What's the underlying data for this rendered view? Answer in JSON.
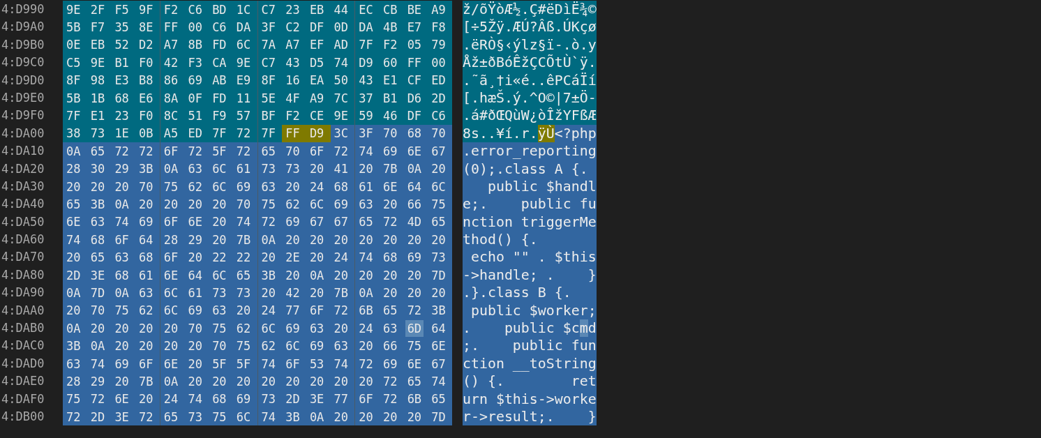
{
  "rows": [
    {
      "address": "4:D990",
      "hex": [
        {
          "kind": "region_a",
          "bytes": [
            "9E",
            "2F",
            "F5",
            "9F",
            "F2",
            "C6",
            "BD",
            "1C",
            "C7",
            "23",
            "EB",
            "44",
            "EC",
            "CB",
            "BE",
            "A9"
          ]
        }
      ],
      "ascii": [
        {
          "kind": "region_a",
          "text": "ž/õŸòÆ½.Ç#ëDìË¾©"
        }
      ]
    },
    {
      "address": "4:D9A0",
      "hex": [
        {
          "kind": "region_a",
          "bytes": [
            "5B",
            "F7",
            "35",
            "8E",
            "FF",
            "00",
            "C6",
            "DA",
            "3F",
            "C2",
            "DF",
            "0D",
            "DA",
            "4B",
            "E7",
            "F8"
          ]
        }
      ],
      "ascii": [
        {
          "kind": "region_a",
          "text": "[÷5Žÿ.ÆÚ?Âß.ÚKçø"
        }
      ]
    },
    {
      "address": "4:D9B0",
      "hex": [
        {
          "kind": "region_a",
          "bytes": [
            "0E",
            "EB",
            "52",
            "D2",
            "A7",
            "8B",
            "FD",
            "6C",
            "7A",
            "A7",
            "EF",
            "AD",
            "7F",
            "F2",
            "05",
            "79"
          ]
        }
      ],
      "ascii": [
        {
          "kind": "region_a",
          "text": ".ëRÒ§‹ýlz§ï-.ò.y"
        }
      ]
    },
    {
      "address": "4:D9C0",
      "hex": [
        {
          "kind": "region_a",
          "bytes": [
            "C5",
            "9E",
            "B1",
            "F0",
            "42",
            "F3",
            "CA",
            "9E",
            "C7",
            "43",
            "D5",
            "74",
            "D9",
            "60",
            "FF",
            "00"
          ]
        }
      ],
      "ascii": [
        {
          "kind": "region_a",
          "text": "Åž±ðBóÊžÇCÕtÙ`ÿ."
        }
      ]
    },
    {
      "address": "4:D9D0",
      "hex": [
        {
          "kind": "region_a",
          "bytes": [
            "8F",
            "98",
            "E3",
            "B8",
            "86",
            "69",
            "AB",
            "E9",
            "8F",
            "16",
            "EA",
            "50",
            "43",
            "E1",
            "CF",
            "ED"
          ]
        }
      ],
      "ascii": [
        {
          "kind": "region_a",
          "text": ".˜ã¸†i«é..êPCáÏí"
        }
      ]
    },
    {
      "address": "4:D9E0",
      "hex": [
        {
          "kind": "region_a",
          "bytes": [
            "5B",
            "1B",
            "68",
            "E6",
            "8A",
            "0F",
            "FD",
            "11",
            "5E",
            "4F",
            "A9",
            "7C",
            "37",
            "B1",
            "D6",
            "2D"
          ]
        }
      ],
      "ascii": [
        {
          "kind": "region_a",
          "text": "[.hæŠ.ý.^O©|7±Ö-"
        }
      ]
    },
    {
      "address": "4:D9F0",
      "hex": [
        {
          "kind": "region_a",
          "bytes": [
            "7F",
            "E1",
            "23",
            "F0",
            "8C",
            "51",
            "F9",
            "57",
            "BF",
            "F2",
            "CE",
            "9E",
            "59",
            "46",
            "DF",
            "C6"
          ]
        }
      ],
      "ascii": [
        {
          "kind": "region_a",
          "text": ".á#ðŒQùW¿òÎžYFßÆ"
        }
      ]
    },
    {
      "address": "4:DA00",
      "hex": [
        {
          "kind": "region_a",
          "bytes": [
            "38",
            "73",
            "1E",
            "0B",
            "A5",
            "ED",
            "7F",
            "72",
            "7F"
          ]
        },
        {
          "kind": "match",
          "bytes": [
            "FF",
            "D9"
          ]
        },
        {
          "kind": "region_b",
          "bytes": [
            "3C",
            "3F",
            "70",
            "68",
            "70"
          ]
        }
      ],
      "ascii": [
        {
          "kind": "region_a",
          "text": "8s..¥í.r."
        },
        {
          "kind": "match",
          "text": "ÿÙ"
        },
        {
          "kind": "region_b",
          "text": "<?php"
        }
      ]
    },
    {
      "address": "4:DA10",
      "hex": [
        {
          "kind": "region_b",
          "bytes": [
            "0A",
            "65",
            "72",
            "72",
            "6F",
            "72",
            "5F",
            "72",
            "65",
            "70",
            "6F",
            "72",
            "74",
            "69",
            "6E",
            "67"
          ]
        }
      ],
      "ascii": [
        {
          "kind": "region_b",
          "text": ".error_reporting"
        }
      ]
    },
    {
      "address": "4:DA20",
      "hex": [
        {
          "kind": "region_b",
          "bytes": [
            "28",
            "30",
            "29",
            "3B",
            "0A",
            "63",
            "6C",
            "61",
            "73",
            "73",
            "20",
            "41",
            "20",
            "7B",
            "0A",
            "20"
          ]
        }
      ],
      "ascii": [
        {
          "kind": "region_b",
          "text": "(0);.class A {. "
        }
      ]
    },
    {
      "address": "4:DA30",
      "hex": [
        {
          "kind": "region_b",
          "bytes": [
            "20",
            "20",
            "20",
            "70",
            "75",
            "62",
            "6C",
            "69",
            "63",
            "20",
            "24",
            "68",
            "61",
            "6E",
            "64",
            "6C"
          ]
        }
      ],
      "ascii": [
        {
          "kind": "region_b",
          "text": "   public $handl"
        }
      ]
    },
    {
      "address": "4:DA40",
      "hex": [
        {
          "kind": "region_b",
          "bytes": [
            "65",
            "3B",
            "0A",
            "20",
            "20",
            "20",
            "20",
            "70",
            "75",
            "62",
            "6C",
            "69",
            "63",
            "20",
            "66",
            "75"
          ]
        }
      ],
      "ascii": [
        {
          "kind": "region_b",
          "text": "e;.    public fu"
        }
      ]
    },
    {
      "address": "4:DA50",
      "hex": [
        {
          "kind": "region_b",
          "bytes": [
            "6E",
            "63",
            "74",
            "69",
            "6F",
            "6E",
            "20",
            "74",
            "72",
            "69",
            "67",
            "67",
            "65",
            "72",
            "4D",
            "65"
          ]
        }
      ],
      "ascii": [
        {
          "kind": "region_b",
          "text": "nction triggerMe"
        }
      ]
    },
    {
      "address": "4:DA60",
      "hex": [
        {
          "kind": "region_b",
          "bytes": [
            "74",
            "68",
            "6F",
            "64",
            "28",
            "29",
            "20",
            "7B",
            "0A",
            "20",
            "20",
            "20",
            "20",
            "20",
            "20",
            "20"
          ]
        }
      ],
      "ascii": [
        {
          "kind": "region_b",
          "text": "thod() {.       "
        }
      ]
    },
    {
      "address": "4:DA70",
      "hex": [
        {
          "kind": "region_b",
          "bytes": [
            "20",
            "65",
            "63",
            "68",
            "6F",
            "20",
            "22",
            "22",
            "20",
            "2E",
            "20",
            "24",
            "74",
            "68",
            "69",
            "73"
          ]
        }
      ],
      "ascii": [
        {
          "kind": "region_b",
          "text": " echo \"\" . $this"
        }
      ]
    },
    {
      "address": "4:DA80",
      "hex": [
        {
          "kind": "region_b",
          "bytes": [
            "2D",
            "3E",
            "68",
            "61",
            "6E",
            "64",
            "6C",
            "65",
            "3B",
            "20",
            "0A",
            "20",
            "20",
            "20",
            "20",
            "7D"
          ]
        }
      ],
      "ascii": [
        {
          "kind": "region_b",
          "text": "->handle; .    }"
        }
      ]
    },
    {
      "address": "4:DA90",
      "hex": [
        {
          "kind": "region_b",
          "bytes": [
            "0A",
            "7D",
            "0A",
            "63",
            "6C",
            "61",
            "73",
            "73",
            "20",
            "42",
            "20",
            "7B",
            "0A",
            "20",
            "20",
            "20"
          ]
        }
      ],
      "ascii": [
        {
          "kind": "region_b",
          "text": ".}.class B {.   "
        }
      ]
    },
    {
      "address": "4:DAA0",
      "hex": [
        {
          "kind": "region_b",
          "bytes": [
            "20",
            "70",
            "75",
            "62",
            "6C",
            "69",
            "63",
            "20",
            "24",
            "77",
            "6F",
            "72",
            "6B",
            "65",
            "72",
            "3B"
          ]
        }
      ],
      "ascii": [
        {
          "kind": "region_b",
          "text": " public $worker;"
        }
      ]
    },
    {
      "address": "4:DAB0",
      "hex": [
        {
          "kind": "region_b",
          "bytes": [
            "0A",
            "20",
            "20",
            "20",
            "20",
            "70",
            "75",
            "62",
            "6C",
            "69",
            "63",
            "20",
            "24",
            "63"
          ]
        },
        {
          "kind": "cursor",
          "bytes": [
            "6D"
          ]
        },
        {
          "kind": "region_b",
          "bytes": [
            "64"
          ]
        }
      ],
      "ascii": [
        {
          "kind": "region_b",
          "text": ".    public $c"
        },
        {
          "kind": "cursor",
          "text": "m"
        },
        {
          "kind": "region_b",
          "text": "d"
        }
      ]
    },
    {
      "address": "4:DAC0",
      "hex": [
        {
          "kind": "region_b",
          "bytes": [
            "3B",
            "0A",
            "20",
            "20",
            "20",
            "20",
            "70",
            "75",
            "62",
            "6C",
            "69",
            "63",
            "20",
            "66",
            "75",
            "6E"
          ]
        }
      ],
      "ascii": [
        {
          "kind": "region_b",
          "text": ";.    public fun"
        }
      ]
    },
    {
      "address": "4:DAD0",
      "hex": [
        {
          "kind": "region_b",
          "bytes": [
            "63",
            "74",
            "69",
            "6F",
            "6E",
            "20",
            "5F",
            "5F",
            "74",
            "6F",
            "53",
            "74",
            "72",
            "69",
            "6E",
            "67"
          ]
        }
      ],
      "ascii": [
        {
          "kind": "region_b",
          "text": "ction __toString"
        }
      ]
    },
    {
      "address": "4:DAE0",
      "hex": [
        {
          "kind": "region_b",
          "bytes": [
            "28",
            "29",
            "20",
            "7B",
            "0A",
            "20",
            "20",
            "20",
            "20",
            "20",
            "20",
            "20",
            "20",
            "72",
            "65",
            "74"
          ]
        }
      ],
      "ascii": [
        {
          "kind": "region_b",
          "text": "() {.        ret"
        }
      ]
    },
    {
      "address": "4:DAF0",
      "hex": [
        {
          "kind": "region_b",
          "bytes": [
            "75",
            "72",
            "6E",
            "20",
            "24",
            "74",
            "68",
            "69",
            "73",
            "2D",
            "3E",
            "77",
            "6F",
            "72",
            "6B",
            "65"
          ]
        }
      ],
      "ascii": [
        {
          "kind": "region_b",
          "text": "urn $this->worke"
        }
      ]
    },
    {
      "address": "4:DB00",
      "hex": [
        {
          "kind": "region_b",
          "bytes": [
            "72",
            "2D",
            "3E",
            "72",
            "65",
            "73",
            "75",
            "6C",
            "74",
            "3B",
            "0A",
            "20",
            "20",
            "20",
            "20",
            "7D"
          ]
        }
      ],
      "ascii": [
        {
          "kind": "region_b",
          "text": "r->result;.    }"
        }
      ]
    }
  ]
}
